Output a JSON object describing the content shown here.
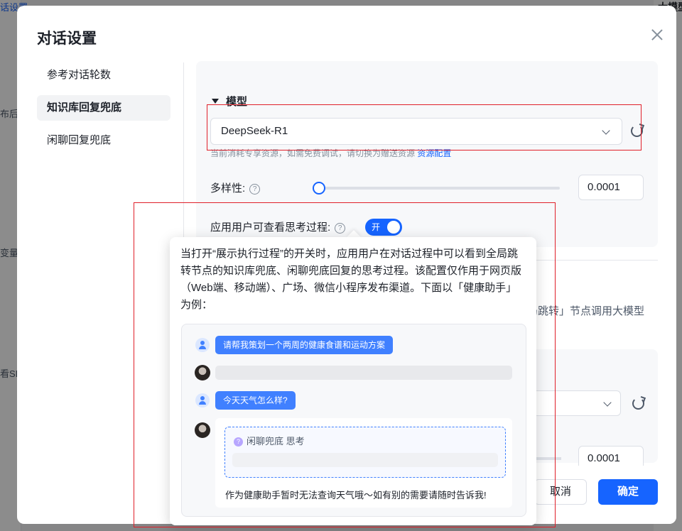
{
  "background": {
    "left_fragments": [
      "话设置",
      "布后",
      "变量",
      "看SI"
    ],
    "right_fragment": "大模型"
  },
  "modal": {
    "title": "对话设置",
    "nav": [
      "参考对话轮数",
      "知识库回复兜底",
      "闲聊回复兜底"
    ],
    "active_nav_index": 1,
    "model_section": {
      "title": "模型",
      "selected_model": "DeepSeek-R1",
      "hint_text": "当前消耗专享资源，如需免费调试，请切换为赠送资源",
      "hint_link": "资源配置",
      "diversity_label": "多样性:",
      "diversity_value": "0.0001",
      "diversity_slider_fraction": 0.0,
      "show_thinking_label": "应用用户可查看思考过程:",
      "toggle_text": "开",
      "toggle_on": true
    },
    "behind_text": "局跳转」节点调用大模型",
    "second_value": "0.0001",
    "cancel_label": "取消",
    "ok_label": "确定"
  },
  "tooltip": {
    "text": "当打开“展示执行过程”的开关时，应用用户在对话过程中可以看到全局跳转节点的知识库兜底、闲聊兜底回复的思考过程。该配置仅作用于网页版（Web端、移动端）、广场、微信小程序发布渠道。下面以「健康助手」为例：",
    "demo": {
      "user_msg_1": "请帮我策划一个两周的健康食谱和运动方案",
      "user_msg_2": "今天天气怎么样?",
      "think_label": "闲聊兜底 思考",
      "reply": "作为健康助手暂时无法查询天气哦～如有别的需要请随时告诉我!"
    }
  },
  "colors": {
    "primary": "#1664ff",
    "annotation_red": "#e0202a",
    "user_bubble": "#4080ff"
  }
}
